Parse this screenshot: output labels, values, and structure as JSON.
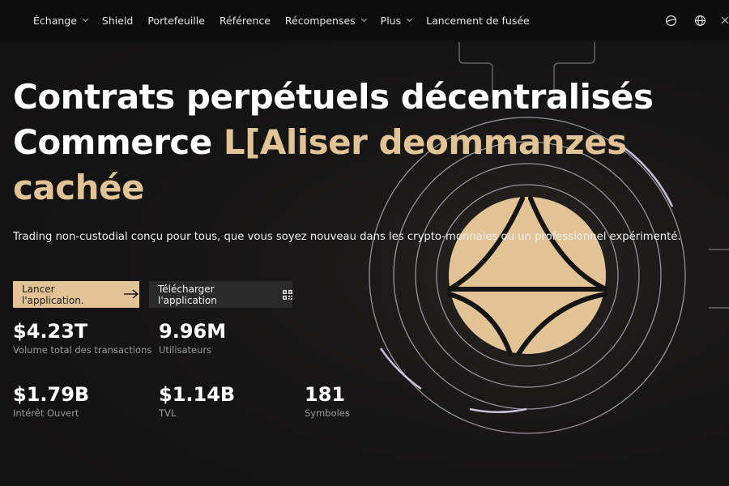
{
  "nav": {
    "items": [
      {
        "label": "Échange",
        "dropdown": true
      },
      {
        "label": "Shield",
        "dropdown": false
      },
      {
        "label": "Portefeuille",
        "dropdown": false
      },
      {
        "label": "Référence",
        "dropdown": false
      },
      {
        "label": "Récompenses",
        "dropdown": true
      },
      {
        "label": "Plus",
        "dropdown": true
      },
      {
        "label": "Lancement de fusée",
        "dropdown": false
      }
    ],
    "right_icons": [
      "theme-icon",
      "globe-icon",
      "x-logo-icon"
    ]
  },
  "hero": {
    "line1": "Contrats perpétuels décentralisés",
    "line2_plain": "Commerce ",
    "line2_accent": "L[Aliser deommanzes",
    "line3_accent": "cachée",
    "subtitle": "Trading non-custodial conçu pour tous, que vous soyez nouveau dans les crypto-monnaies ou un professionnel expérimenté."
  },
  "buttons": {
    "launch_label": "Lancer l'application.",
    "download_label": "Télécharger l'application"
  },
  "stats": {
    "volume": {
      "value": "$4.23T",
      "label": "Volume total des transactions"
    },
    "users": {
      "value": "9.96M",
      "label": "Utilisateurs"
    },
    "open_interest": {
      "value": "$1.79B",
      "label": "Intérêt Ouvert"
    },
    "tvl": {
      "value": "$1.14B",
      "label": "TVL"
    },
    "symbols": {
      "value": "181",
      "label": "Symboles"
    }
  },
  "colors": {
    "accent": "#e2c396",
    "background": "#141313",
    "nav_background": "#0c0c0c",
    "secondary_button": "#2b2a2a",
    "muted_text": "#9a9a9a"
  }
}
